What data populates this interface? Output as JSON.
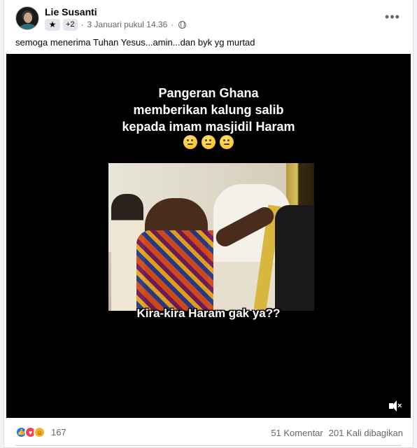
{
  "post": {
    "author_name": "Lie Susanti",
    "badge_count": "+2",
    "timestamp": "3 Januari pukul 14.36",
    "separator": "·",
    "caption": "semoga menerima Tuhan Yesus...amin...dan byk yg murtad",
    "more_label": "•••"
  },
  "video": {
    "overlay_lines": [
      "Pangeran Ghana",
      "memberikan kalung salib",
      "kepada imam masjidil Haram"
    ],
    "emoji_icons": [
      "thinking-face-icon",
      "thinking-face-icon",
      "thinking-face-icon"
    ],
    "bottom_text": "Kira-kira Haram gak ya??",
    "mute_symbol": "×"
  },
  "footer": {
    "reactions": [
      "like-icon",
      "love-icon",
      "haha-icon"
    ],
    "reaction_count": "167",
    "comments": "51 Komentar",
    "shares": "201 Kali dibagikan"
  },
  "colors": {
    "background": "#f0f2f5",
    "card": "#ffffff",
    "secondary_text": "#65676b",
    "like_blue": "#1877f2",
    "love_red": "#f33e58",
    "haha_yellow": "#f7b125"
  }
}
